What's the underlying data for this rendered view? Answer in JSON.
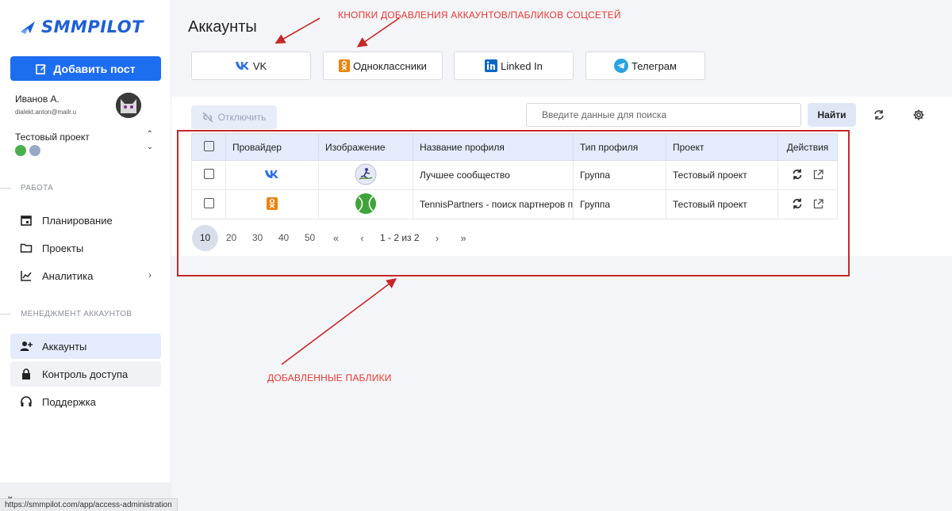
{
  "brand": {
    "name": "SMMPILOT"
  },
  "sidebar": {
    "add_post_label": "Добавить пост",
    "user": {
      "name": "Иванов А.",
      "email": "dialekt.anton@mailr.u"
    },
    "project": {
      "name": "Тестовый проект"
    },
    "sections": [
      {
        "title": "РАБОТА"
      },
      {
        "title": "МЕНЕДЖМЕНТ АККАУНТОВ"
      }
    ],
    "items": [
      {
        "label": "Планирование",
        "icon": "calendar-icon"
      },
      {
        "label": "Проекты",
        "icon": "folder-icon"
      },
      {
        "label": "Аналитика",
        "icon": "chart-icon"
      },
      {
        "label": "Аккаунты",
        "icon": "add-user-icon"
      },
      {
        "label": "Контроль доступа",
        "icon": "lock-icon"
      },
      {
        "label": "Поддержка",
        "icon": "headset-icon"
      }
    ]
  },
  "status_url": "https://smmpilot.com/app/access-administration",
  "page": {
    "title": "Аккаунты"
  },
  "social_buttons": [
    {
      "label": "VK",
      "icon": "vk-icon",
      "color": "#2f6fe6"
    },
    {
      "label": "Одноклассники",
      "icon": "ok-icon",
      "color": "#ee8208"
    },
    {
      "label": "Linked In",
      "icon": "linkedin-icon",
      "color": "#0a66c2"
    },
    {
      "label": "Телеграм",
      "icon": "telegram-icon",
      "color": "#2aa3e0"
    }
  ],
  "toolbar": {
    "disable_label": "Отключить",
    "search_placeholder": "Введите данные для поиска",
    "find_label": "Найти"
  },
  "table": {
    "headers": [
      "Провайдер",
      "Изображение",
      "Название профиля",
      "Тип профиля",
      "Проект",
      "Действия"
    ],
    "rows": [
      {
        "provider": "VK",
        "name": "Лучшее сообщество",
        "type": "Группа",
        "project": "Тестовый проект"
      },
      {
        "provider": "OK",
        "name": "TennisPartners - поиск партнеров п",
        "type": "Группа",
        "project": "Тестовый проект"
      }
    ]
  },
  "pagination": {
    "sizes": [
      "10",
      "20",
      "30",
      "40",
      "50"
    ],
    "active_size": "10",
    "range": "1 - 2 из 2"
  },
  "annotations": {
    "buttons_note": "КНОПКИ ДОБАВЛЕНИЯ АККАУНТОВ/ПАБЛИКОВ СОЦСЕТЕЙ",
    "added_note": "ДОБАВЛЕННЫЕ ПАБЛИКИ",
    "color": "#e53935"
  }
}
